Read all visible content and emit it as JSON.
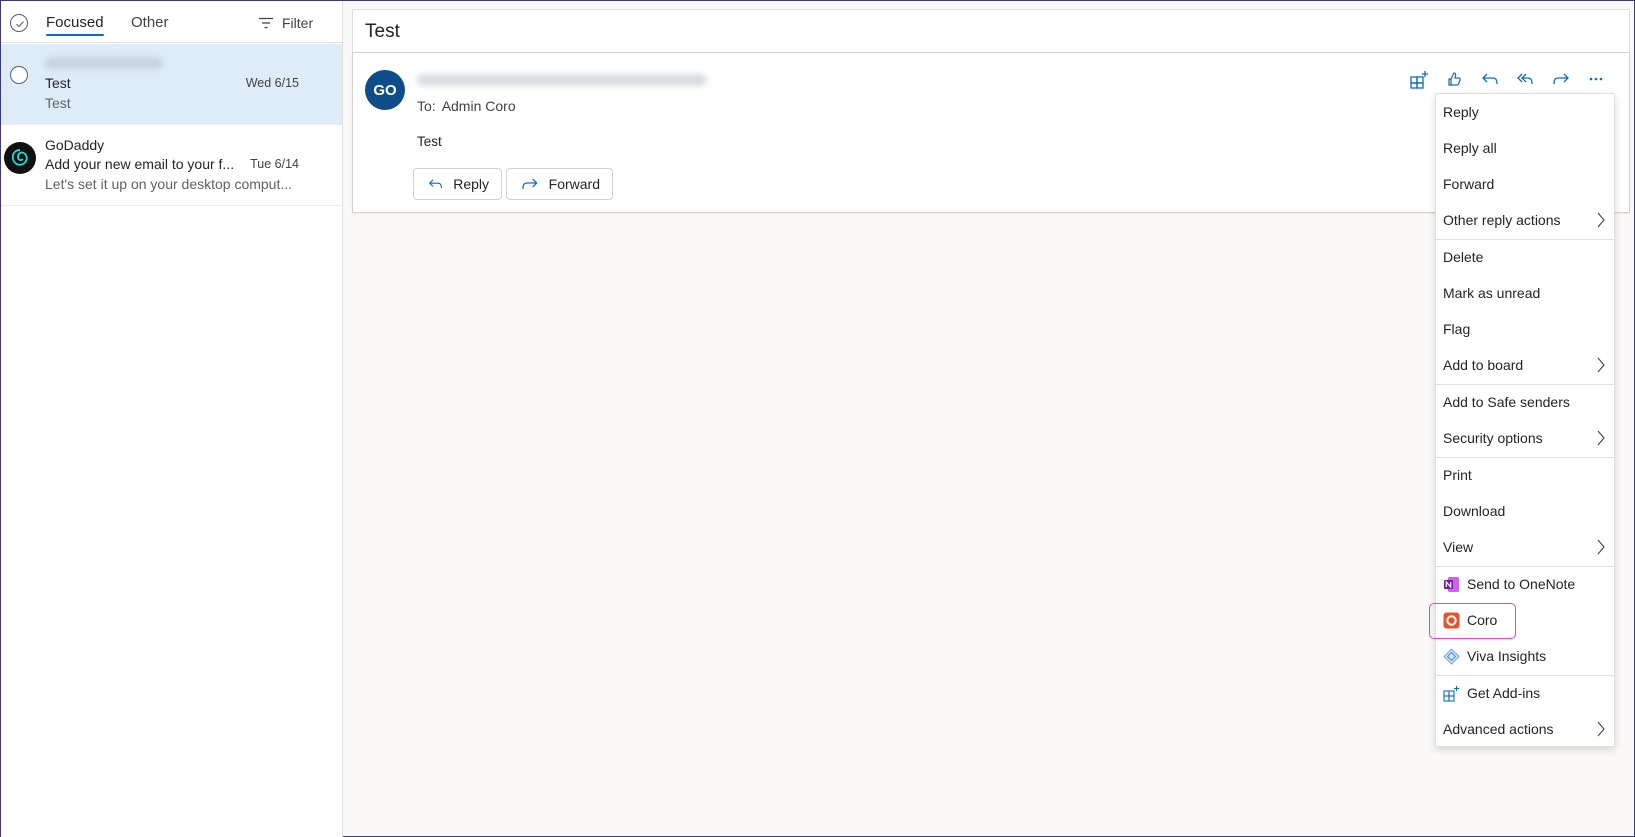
{
  "list": {
    "tabs": [
      {
        "label": "Focused"
      },
      {
        "label": "Other"
      }
    ],
    "filter_label": "Filter",
    "items": [
      {
        "sender": "",
        "subject": "Test",
        "date": "Wed 6/15",
        "preview": "Test"
      },
      {
        "sender": "GoDaddy",
        "subject": "Add your new email to your f...",
        "date": "Tue 6/14",
        "preview": "Let's set it up on your desktop comput..."
      }
    ]
  },
  "reading": {
    "subject": "Test",
    "avatar_initials": "GO",
    "to_label": "To:",
    "to_name": "Admin Coro",
    "body": "Test",
    "reply_label": "Reply",
    "forward_label": "Forward"
  },
  "toolbar": {
    "icons": [
      "apps-icon",
      "like-icon",
      "reply-icon",
      "reply-all-icon",
      "forward-icon",
      "more-icon"
    ]
  },
  "menu": {
    "items": [
      {
        "label": "Reply"
      },
      {
        "label": "Reply all"
      },
      {
        "label": "Forward"
      },
      {
        "label": "Other reply actions"
      },
      {
        "label": "Delete"
      },
      {
        "label": "Mark as unread"
      },
      {
        "label": "Flag"
      },
      {
        "label": "Add to board"
      },
      {
        "label": "Add to Safe senders"
      },
      {
        "label": "Security options"
      },
      {
        "label": "Print"
      },
      {
        "label": "Download"
      },
      {
        "label": "View"
      },
      {
        "label": "Send to OneNote"
      },
      {
        "label": "Coro"
      },
      {
        "label": "Viva Insights"
      },
      {
        "label": "Get Add-ins"
      },
      {
        "label": "Advanced actions"
      }
    ]
  },
  "colors": {
    "accent": "#0f6cbd",
    "selected_row": "#deecf9",
    "highlight": "#e83fcf",
    "avatar": "#0f4c8a"
  }
}
